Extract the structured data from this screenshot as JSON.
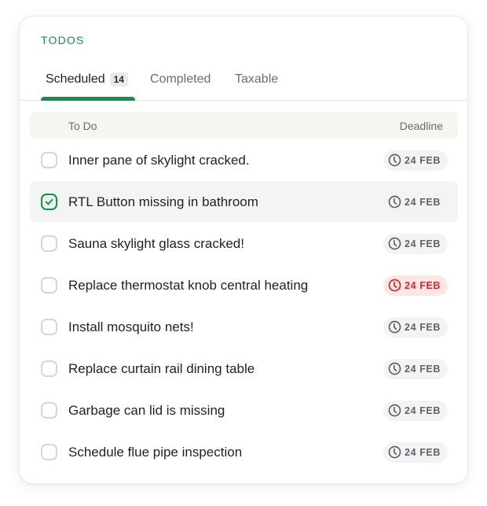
{
  "card": {
    "title": "TODOS",
    "accent_color": "#149150",
    "overdue_color": "#d12a2a"
  },
  "tabs": [
    {
      "label": "Scheduled",
      "count": "14",
      "active": true
    },
    {
      "label": "Completed",
      "active": false
    },
    {
      "label": "Taxable",
      "active": false
    }
  ],
  "table": {
    "headers": {
      "todo": "To Do",
      "deadline": "Deadline"
    },
    "rows": [
      {
        "label": "Inner pane of skylight cracked.",
        "deadline": "24 FEB",
        "checked": false,
        "overdue": false,
        "icon": "clock-icon"
      },
      {
        "label": "RTL Button missing in bathroom",
        "deadline": "24 FEB",
        "checked": true,
        "overdue": false,
        "icon": "clock-icon"
      },
      {
        "label": "Sauna skylight glass cracked!",
        "deadline": "24 FEB",
        "checked": false,
        "overdue": false,
        "icon": "clock-icon"
      },
      {
        "label": "Replace thermostat knob central heating",
        "deadline": "24 FEB",
        "checked": false,
        "overdue": true,
        "icon": "clock-icon"
      },
      {
        "label": "Install mosquito nets!",
        "deadline": "24 FEB",
        "checked": false,
        "overdue": false,
        "icon": "clock-icon"
      },
      {
        "label": "Replace curtain rail dining table",
        "deadline": "24 FEB",
        "checked": false,
        "overdue": false,
        "icon": "clock-icon"
      },
      {
        "label": "Garbage can lid is missing",
        "deadline": "24 FEB",
        "checked": false,
        "overdue": false,
        "icon": "clock-icon"
      },
      {
        "label": "Schedule flue pipe inspection",
        "deadline": "24 FEB",
        "checked": false,
        "overdue": false,
        "icon": "clock-icon"
      }
    ]
  }
}
